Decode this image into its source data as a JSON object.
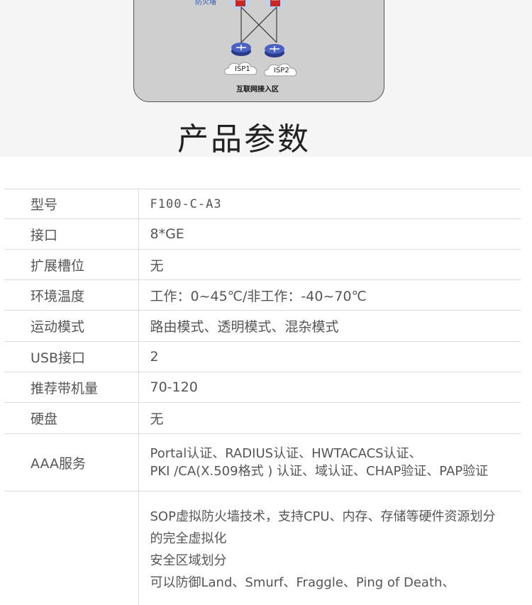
{
  "diagram": {
    "firewall_label": "防火墙",
    "isp_labels": [
      "ISP1",
      "ISP2"
    ],
    "zone_label": "互联网接入区"
  },
  "section_title": "产品参数",
  "spec_rows": [
    {
      "label": "型号",
      "value": [
        "F100-C-A3"
      ]
    },
    {
      "label": "接口",
      "value": [
        "8*GE"
      ]
    },
    {
      "label": "扩展槽位",
      "value": [
        "无"
      ]
    },
    {
      "label": "环境温度",
      "value": [
        "工作：0~45℃/非工作：-40~70℃"
      ]
    },
    {
      "label": "运动模式",
      "value": [
        "路由模式、透明模式、混杂模式"
      ]
    },
    {
      "label": "USB接口",
      "value": [
        "2"
      ]
    },
    {
      "label": "推荐带机量",
      "value": [
        "70-120"
      ]
    },
    {
      "label": "硬盘",
      "value": [
        "无"
      ]
    },
    {
      "label": "AAA服务",
      "value": [
        "Portal认证、RADIUS认证、HWTACACS认证、",
        "PKI /CA(X.509格式 ) 认证、域认证、CHAP验证、PAP验证"
      ]
    },
    {
      "label": "",
      "value": [
        "SOP虚拟防火墙技术，支持CPU、内存、存储等硬件资源划分",
        "的完全虚拟化",
        "安全区域划分",
        "可以防御Land、Smurf、Fraggle、Ping of Death、"
      ]
    }
  ]
}
